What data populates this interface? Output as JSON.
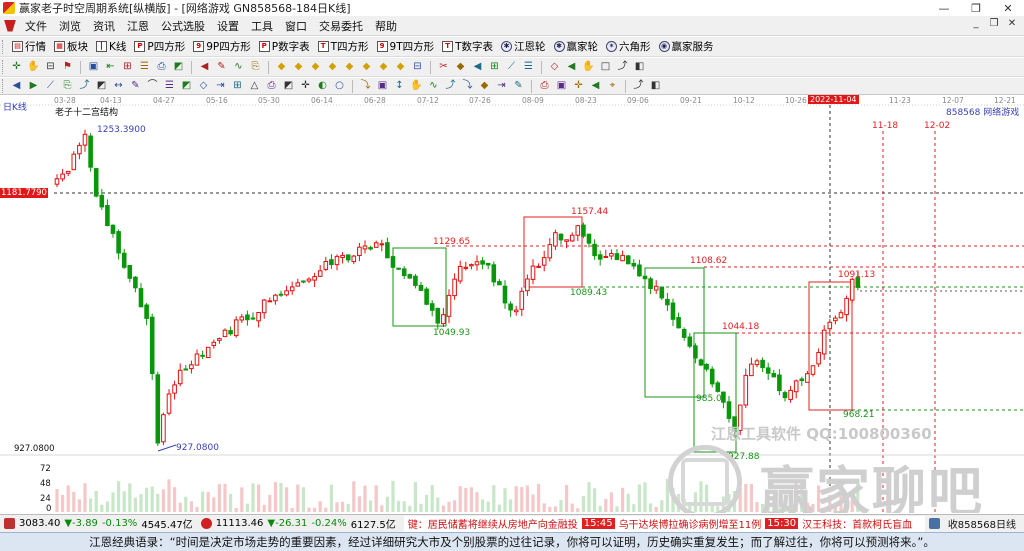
{
  "window": {
    "title": "赢家老子时空周期系统[纵横版] - [网络游戏  GN858568-184日K线]",
    "minimize": "—",
    "restore": "❐",
    "close": "✕"
  },
  "menu": {
    "items": [
      "文件",
      "浏览",
      "资讯",
      "江恩",
      "公式选股",
      "设置",
      "工具",
      "窗口",
      "交易委托",
      "帮助"
    ],
    "mdi_minimize": "_",
    "mdi_restore": "❐",
    "mdi_close": "✕"
  },
  "toolbar1": {
    "buttons": [
      {
        "label": "行情",
        "icon": "quotes-icon"
      },
      {
        "label": "板块",
        "icon": "sector-icon"
      },
      {
        "label": "K线",
        "icon": "kline-icon"
      },
      {
        "label": "P四方形",
        "icon": "p-square-icon"
      },
      {
        "label": "9P四方形",
        "icon": "9p-square-icon"
      },
      {
        "label": "P数字表",
        "icon": "p-table-icon"
      },
      {
        "label": "T四方形",
        "icon": "t-square-icon"
      },
      {
        "label": "9T四方形",
        "icon": "9t-square-icon"
      },
      {
        "label": "T数字表",
        "icon": "t-table-icon"
      },
      {
        "label": "江恩轮",
        "icon": "gann-wheel-icon"
      },
      {
        "label": "赢家轮",
        "icon": "winner-wheel-icon"
      },
      {
        "label": "六角形",
        "icon": "hexagon-icon"
      },
      {
        "label": "赢家服务",
        "icon": "service-icon"
      }
    ]
  },
  "toolbar2": {
    "icons": [
      "grid-icon",
      "chart-type-icon",
      "period-icon",
      "pattern-icon",
      "|",
      "flag-icon",
      "frame-icon",
      "shift-left-icon",
      "shift-right-icon",
      "zoom-in-icon",
      "zoom-out-icon",
      "|",
      "first-icon",
      "prev-icon",
      "next-icon",
      "last-icon",
      "|",
      "diamond-1-icon",
      "diamond-2-icon",
      "diamond-3-icon",
      "diamond-4-icon",
      "diamond-5-icon",
      "diamond-6-icon",
      "diamond-7-icon",
      "diamond-8-icon",
      "table-icon",
      "|",
      "hand-icon",
      "cross-icon",
      "magnet-icon",
      "text-tool-icon",
      "chat-icon",
      "pin-icon",
      "|",
      "save-icon",
      "copy-icon",
      "print-icon",
      "export-icon",
      "stack-icon",
      "link-icon"
    ]
  },
  "toolbar3": {
    "icons": [
      "line-tool-icon",
      "ray-icon",
      "channel-icon",
      "parallel-icon",
      "fan-icon",
      "fib-icon",
      "arc-icon",
      "circle-icon",
      "ellipse-icon",
      "rect-icon",
      "triangle-icon",
      "arrow-icon",
      "wave-icon",
      "gann-fan-icon",
      "gann-box-icon",
      "cycle-icon",
      "spiral-icon",
      "angle-icon",
      "measure-icon",
      "period-line-icon",
      "|",
      "vline-icon",
      "hline-icon",
      "speed-icon",
      "pitchfork-icon",
      "percent-icon",
      "time-zone-icon",
      "box-icon",
      "trend-icon",
      "ruler-icon",
      "clone-icon",
      "|",
      "square-icon",
      "calendar-icon",
      "delete-icon",
      "undo-icon",
      "redo-icon",
      "|",
      "color-icon",
      "loop-icon"
    ]
  },
  "chart": {
    "period_label": "日K线",
    "right_title": "858568  网络游戏",
    "structure_label": "老子十二宫结构",
    "dates": [
      "03-28",
      "04-13",
      "04-27",
      "05-16",
      "05-30",
      "06-14",
      "06-28",
      "07-12",
      "07-26",
      "08-09",
      "08-23",
      "09-06",
      "09-21",
      "10-12",
      "10-26"
    ],
    "highlight_date": "2022-11-04",
    "dates_after": [
      "11-23",
      "12-07",
      "12-21"
    ],
    "price_high": "1253.3900",
    "price_left_box": "1181.7790",
    "price_low_axis": "927.0800",
    "price_low": "927.0800",
    "levels": {
      "l1129": "1129.65",
      "l1157": "1157.44",
      "l1089": "1089.43",
      "l1049": "1049.93",
      "l1108": "1108.62",
      "l1044": "1044.18",
      "l985": "985.0",
      "l927": "927.88",
      "l1091": "1091.13",
      "l968": "968.21"
    },
    "future_date_1": "11-18",
    "future_date_2": "12-02",
    "volume_axis": [
      "72",
      "48",
      "24",
      "0"
    ],
    "watermark_1": "江恩工具软件  QQ:100800360",
    "watermark_2": "赢家聊吧"
  },
  "status": {
    "sh_price": "3083.40",
    "sh_change": "▼-3.89",
    "sh_pct": "-0.13%",
    "sh_amount": "4545.47亿",
    "sz_price": "11113.46",
    "sz_change": "▼-26.31",
    "sz_pct": "-0.24%",
    "sz_amount": "6127.5亿",
    "news_1": "键：居民储蓄将继续从房地产向金融投",
    "time_1": "15:45",
    "news_2": "乌干达埃博拉确诊病例增至11例",
    "time_2": "15:30",
    "news_3": "汉王科技：首款柯氏盲血",
    "right": "收858568日线"
  },
  "quote": "江恩经典语录：“时间是决定市场走势的重要因素，经过详细研究大市及个别股票的过往记录，你将可以证明，历史确实重复发生；而了解过往，你将可以预测将来。”。"
}
